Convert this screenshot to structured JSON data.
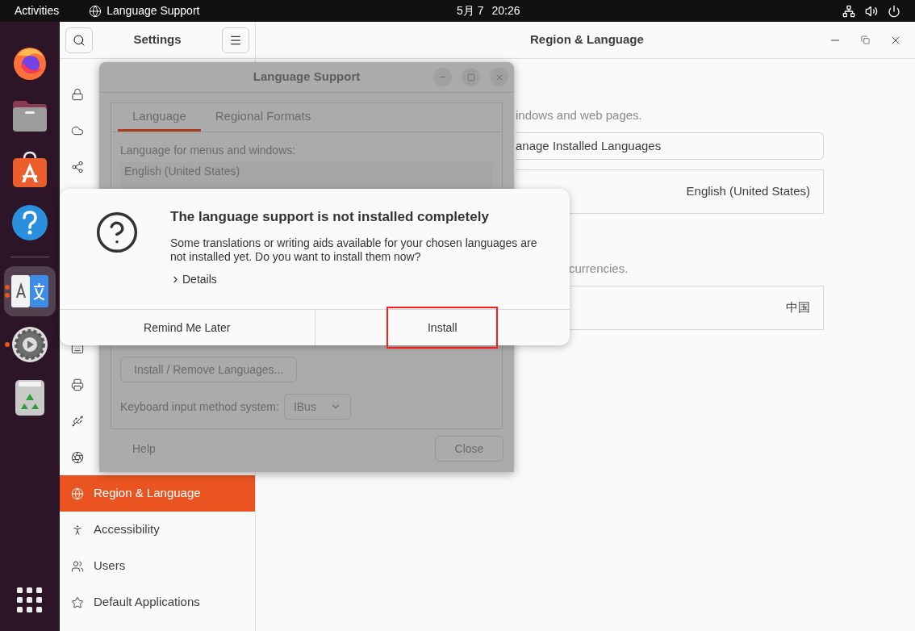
{
  "top_bar": {
    "activities": "Activities",
    "app_name": "Language Support",
    "date": "5月 7",
    "time": "20:26"
  },
  "dock": {
    "items": [
      {
        "kind": "firefox",
        "focused": false,
        "running": false
      },
      {
        "kind": "files",
        "focused": false,
        "running": false
      },
      {
        "kind": "software",
        "focused": false,
        "running": false
      },
      {
        "kind": "help",
        "focused": false,
        "running": false
      },
      {
        "kind": "language",
        "focused": true,
        "running": true,
        "multiple": true
      },
      {
        "kind": "settings",
        "focused": false,
        "running": true,
        "multiple": false
      },
      {
        "kind": "trash",
        "focused": false,
        "running": false
      }
    ]
  },
  "settings": {
    "title": "Settings",
    "panel_title": "Region & Language",
    "sidebar_covered_top": [
      {
        "kind": "lock"
      },
      {
        "kind": "cloud"
      },
      {
        "kind": "share"
      }
    ],
    "sidebar_covered_bottom": [
      {
        "kind": "keyboard"
      },
      {
        "kind": "printer"
      },
      {
        "kind": "usb"
      },
      {
        "kind": "color"
      }
    ],
    "sidebar_items": [
      {
        "kind": "globe",
        "label": "Region & Language",
        "selected": true
      },
      {
        "kind": "accessibility",
        "label": "Accessibility",
        "selected": false
      },
      {
        "kind": "users",
        "label": "Users",
        "selected": false
      },
      {
        "kind": "star",
        "label": "Default Applications",
        "selected": false
      }
    ],
    "content": {
      "language_note": "indows and web pages.",
      "manage_button": "anage Installed Languages",
      "language_value": "English (United States)",
      "formats_note": "currencies.",
      "formats_value": "中国"
    }
  },
  "language_support": {
    "title": "Language Support",
    "tabs": [
      {
        "label": "Language",
        "selected": true
      },
      {
        "label": "Regional Formats",
        "selected": false
      }
    ],
    "list_label": "Language for menus and windows:",
    "list_items": [
      "English (United States)"
    ],
    "install_remove_button": "Install / Remove Languages...",
    "input_method_label": "Keyboard input method system:",
    "input_method_value": "IBus",
    "help_button": "Help",
    "close_button": "Close"
  },
  "dialog": {
    "title": "The language support is not installed completely",
    "message": "Some translations or writing aids available for your chosen languages are not installed yet. Do you want to install them now?",
    "details": "Details",
    "details_expanded": false,
    "buttons": [
      {
        "label": "Remind Me Later",
        "highlighted": false
      },
      {
        "label": "Install",
        "highlighted": true
      }
    ]
  }
}
